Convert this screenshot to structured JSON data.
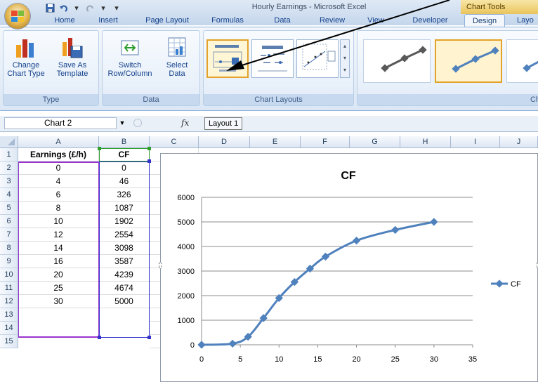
{
  "window": {
    "title": "Hourly Earnings - Microsoft Excel",
    "context_tab": "Chart Tools"
  },
  "tabs": [
    {
      "label": "Home"
    },
    {
      "label": "Insert"
    },
    {
      "label": "Page Layout"
    },
    {
      "label": "Formulas"
    },
    {
      "label": "Data"
    },
    {
      "label": "Review"
    },
    {
      "label": "View"
    },
    {
      "label": "Developer"
    },
    {
      "label": "Design"
    },
    {
      "label": "Layo"
    }
  ],
  "active_tab": "Design",
  "ribbon": {
    "type_group": {
      "label": "Type",
      "change_chart_type": "Change\nChart Type",
      "save_as_template": "Save As\nTemplate"
    },
    "data_group": {
      "label": "Data",
      "switch_row_column": "Switch\nRow/Column",
      "select_data": "Select\nData"
    },
    "layouts_group": {
      "label": "Chart Layouts"
    },
    "styles_group": {
      "label": "Ch"
    }
  },
  "formula_bar": {
    "name_box": "Chart 2",
    "fx": "fx",
    "tooltip": "Layout 1"
  },
  "columns": [
    "A",
    "B",
    "C",
    "D",
    "E",
    "F",
    "G",
    "H",
    "I",
    "J"
  ],
  "rows": [
    "1",
    "2",
    "3",
    "4",
    "5",
    "6",
    "7",
    "8",
    "9",
    "10",
    "11",
    "12",
    "13",
    "14",
    "15"
  ],
  "table": {
    "headers": [
      "Earnings (£/h)",
      "CF"
    ],
    "rows": [
      [
        "0",
        "0"
      ],
      [
        "4",
        "46"
      ],
      [
        "6",
        "326"
      ],
      [
        "8",
        "1087"
      ],
      [
        "10",
        "1902"
      ],
      [
        "12",
        "2554"
      ],
      [
        "14",
        "3098"
      ],
      [
        "16",
        "3587"
      ],
      [
        "20",
        "4239"
      ],
      [
        "25",
        "4674"
      ],
      [
        "30",
        "5000"
      ]
    ]
  },
  "colors": {
    "series": "#4f81bd",
    "selection_purple": "#9933cc",
    "selection_blue": "#3333cc",
    "selection_green": "#2e9e2e",
    "accent_orange": "#e3a22a"
  },
  "chart_data": {
    "type": "scatter",
    "title": "CF",
    "xlabel": "",
    "ylabel": "",
    "x_ticks": [
      "0",
      "5",
      "10",
      "15",
      "20",
      "25",
      "30",
      "35"
    ],
    "y_ticks": [
      "0",
      "1000",
      "2000",
      "3000",
      "4000",
      "5000",
      "6000"
    ],
    "xlim": [
      0,
      35
    ],
    "ylim": [
      0,
      6000
    ],
    "grid": "horizontal",
    "legend_position": "right",
    "series": [
      {
        "name": "CF",
        "x": [
          0,
          4,
          6,
          8,
          10,
          12,
          14,
          16,
          20,
          25,
          30
        ],
        "y": [
          0,
          46,
          326,
          1087,
          1902,
          2554,
          3098,
          3587,
          4239,
          4674,
          5000
        ]
      }
    ]
  }
}
